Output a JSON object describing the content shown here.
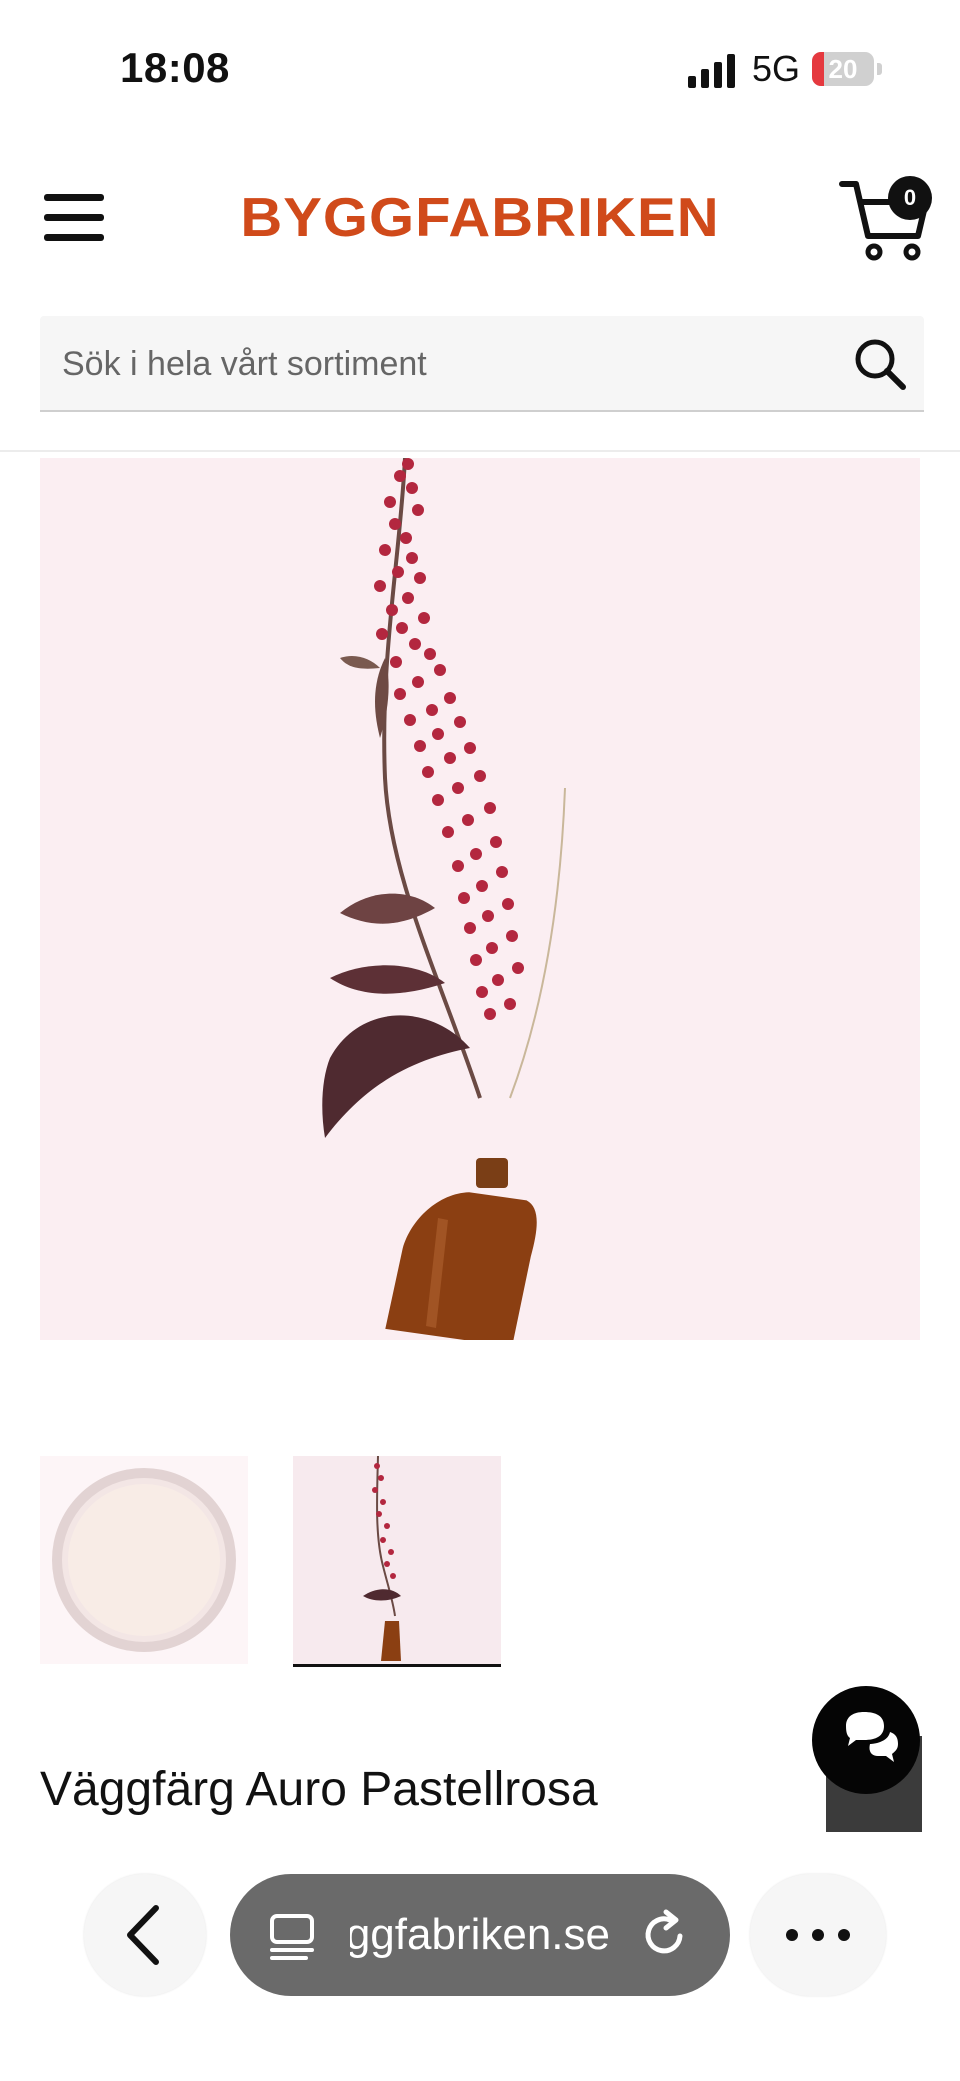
{
  "status_bar": {
    "time": "18:08",
    "network": "5G",
    "battery_level": "20",
    "battery_fraction": 0.2,
    "battery_color": "#e5393f"
  },
  "header": {
    "menu_icon": "hamburger-menu-icon",
    "logo": "BYGGFABRIKEN",
    "logo_color": "#d04a1a",
    "cart_icon": "shopping-cart-icon",
    "cart_count": "0"
  },
  "search": {
    "placeholder": "Sök i hela vårt sortiment",
    "icon": "search-icon"
  },
  "product": {
    "title": "Väggfärg Auro Pastellrosa"
  },
  "chat": {
    "icon": "chat-bubbles-icon"
  },
  "browser_bar": {
    "back_icon": "chevron-left-icon",
    "url": "byggfabriken.se",
    "tabs_icon": "reader-icon",
    "reload_icon": "reload-icon",
    "more_icon": "more-dots-icon"
  }
}
